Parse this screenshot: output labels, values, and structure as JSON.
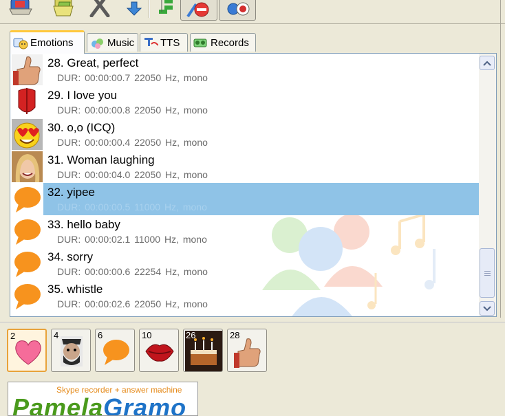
{
  "tabs": [
    {
      "label": "Emotions",
      "icon": "emotions-icon",
      "active": true
    },
    {
      "label": "Music",
      "icon": "music-icon",
      "active": false
    },
    {
      "label": "TTS",
      "icon": "tts-icon",
      "active": false
    },
    {
      "label": "Records",
      "icon": "records-icon",
      "active": false
    }
  ],
  "sounds": [
    {
      "title": "28. Great, perfect",
      "meta": "DUR: 00:00:00.7   22050 Hz, mono",
      "thumb": "thumbs-up-icon",
      "selected": false
    },
    {
      "title": "29. I love you",
      "meta": "DUR: 00:00:00.8   22050 Hz, mono",
      "thumb": "red-tulip-icon",
      "selected": false
    },
    {
      "title": "30. o,o (ICQ)",
      "meta": "DUR: 00:00:00.4   22050 Hz, mono",
      "thumb": "heart-eyes-icon",
      "selected": false
    },
    {
      "title": "31. Woman laughing",
      "meta": "DUR: 00:00:04.0   22050 Hz, mono",
      "thumb": "woman-photo-icon",
      "selected": false
    },
    {
      "title": "32. yipee",
      "meta": "DUR: 00:00:00.5   11000 Hz, mono",
      "thumb": "speech-bubble-icon",
      "selected": true
    },
    {
      "title": "33. hello baby",
      "meta": "DUR: 00:00:02.1   11000 Hz, mono",
      "thumb": "speech-bubble-icon",
      "selected": false
    },
    {
      "title": "34. sorry",
      "meta": "DUR: 00:00:00.6   22254 Hz, mono",
      "thumb": "speech-bubble-icon",
      "selected": false
    },
    {
      "title": "35. whistle",
      "meta": "DUR: 00:00:02.6   22050 Hz, mono",
      "thumb": "speech-bubble-icon",
      "selected": false
    }
  ],
  "favorites": [
    {
      "num": "2",
      "icon": "heart-icon",
      "active": true
    },
    {
      "num": "4",
      "icon": "cartoon-face-icon",
      "active": false
    },
    {
      "num": "6",
      "icon": "speech-bubble-icon",
      "active": false
    },
    {
      "num": "10",
      "icon": "lips-icon",
      "active": false
    },
    {
      "num": "26",
      "icon": "birthday-cake-icon",
      "active": false
    },
    {
      "num": "28",
      "icon": "thumbs-up-icon",
      "active": false
    }
  ],
  "banner": {
    "tagline": "Skype recorder + answer machine",
    "logo_a": "Pamela",
    "logo_b": "Gramo"
  },
  "colors": {
    "selection": "#8fc3e7",
    "bubble": "#f7931e",
    "tab_active_accent": "#ffc83c",
    "panel_border": "#7f9db9"
  }
}
